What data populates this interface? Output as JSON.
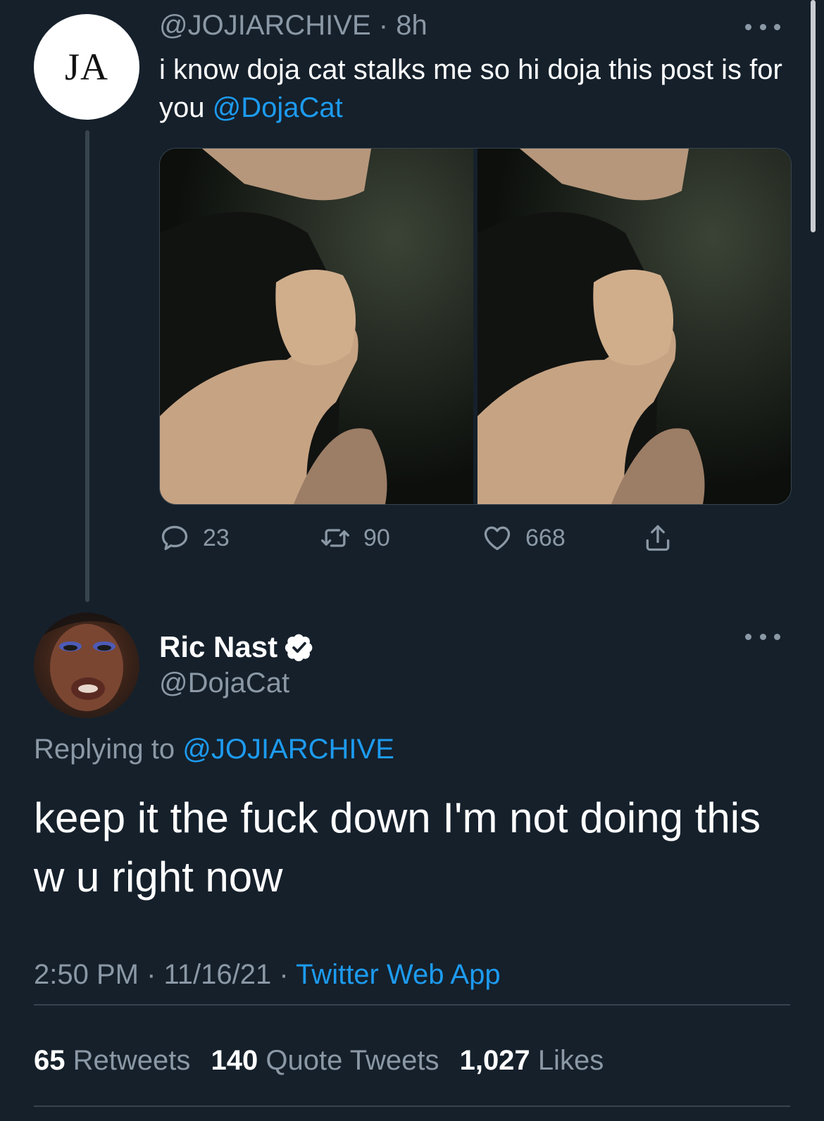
{
  "parent_tweet": {
    "avatar_initials": "JA",
    "handle": "@JOJIARCHIVE",
    "separator": "·",
    "time": "8h",
    "text_before": "i know doja cat stalks me so hi doja this post is for you ",
    "mention": "@DojaCat",
    "actions": {
      "reply_count": "23",
      "retweet_count": "90",
      "like_count": "668"
    }
  },
  "reply_tweet": {
    "display_name": "Ric Nast",
    "handle": "@DojaCat",
    "replying_label": "Replying to ",
    "replying_handle": "@JOJIARCHIVE",
    "text": "keep it the fuck down I'm not doing this w u right now",
    "time": "2:50 PM",
    "date": "11/16/21",
    "sep": " · ",
    "app": "Twitter Web App",
    "stats": {
      "retweets_count": "65",
      "retweets_label": "Retweets",
      "quotes_count": "140",
      "quotes_label": "Quote Tweets",
      "likes_count": "1,027",
      "likes_label": "Likes"
    }
  },
  "icons": [
    "more-icon",
    "reply-icon",
    "retweet-icon",
    "like-icon",
    "share-icon",
    "verified-badge-icon"
  ],
  "colors": {
    "background": "#15202b",
    "text": "#ffffff",
    "secondary": "#8b98a5",
    "accent": "#1d9bf0",
    "divider": "#38444d"
  }
}
